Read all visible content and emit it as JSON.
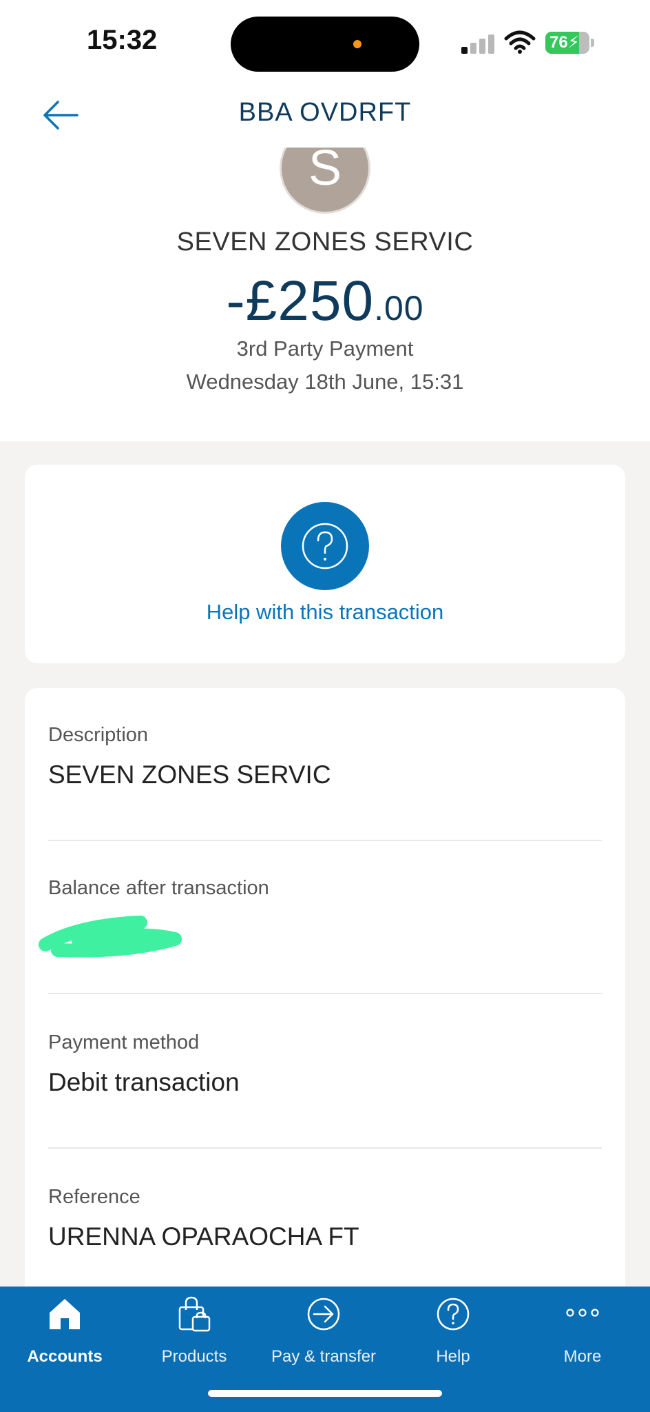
{
  "status_bar": {
    "time": "15:32",
    "battery_level": "76",
    "battery_fraction": 0.76,
    "signal_bars_active": 1,
    "signal_bars_total": 4
  },
  "header": {
    "title": "BBA OVDRFT",
    "back_icon": "arrow-left-icon"
  },
  "transaction": {
    "avatar_letter": "S",
    "merchant": "SEVEN ZONES SERVIC",
    "amount_main": "-£250",
    "amount_pence": ".00",
    "type": "3rd Party Payment",
    "datetime": "Wednesday 18th June, 15:31"
  },
  "help": {
    "label": "Help with this transaction",
    "icon": "question-circle-icon"
  },
  "details": [
    {
      "label": "Description",
      "value": "SEVEN ZONES SERVIC"
    },
    {
      "label": "Balance after transaction",
      "value": ""
    },
    {
      "label": "Payment method",
      "value": "Debit transaction"
    },
    {
      "label": "Reference",
      "value": "URENNA OPARAOCHA FT"
    }
  ],
  "tabs": [
    {
      "label": "Accounts",
      "icon": "home-icon",
      "active": true
    },
    {
      "label": "Products",
      "icon": "shopping-bag-icon",
      "active": false
    },
    {
      "label": "Pay & transfer",
      "icon": "arrow-circle-icon",
      "active": false
    },
    {
      "label": "Help",
      "icon": "question-circle-icon",
      "active": false
    },
    {
      "label": "More",
      "icon": "more-dots-icon",
      "active": false
    }
  ],
  "colors": {
    "brand_blue": "#0a6eb4",
    "navy_text": "#0e3a5b",
    "redaction_green": "#3ef0a0"
  }
}
